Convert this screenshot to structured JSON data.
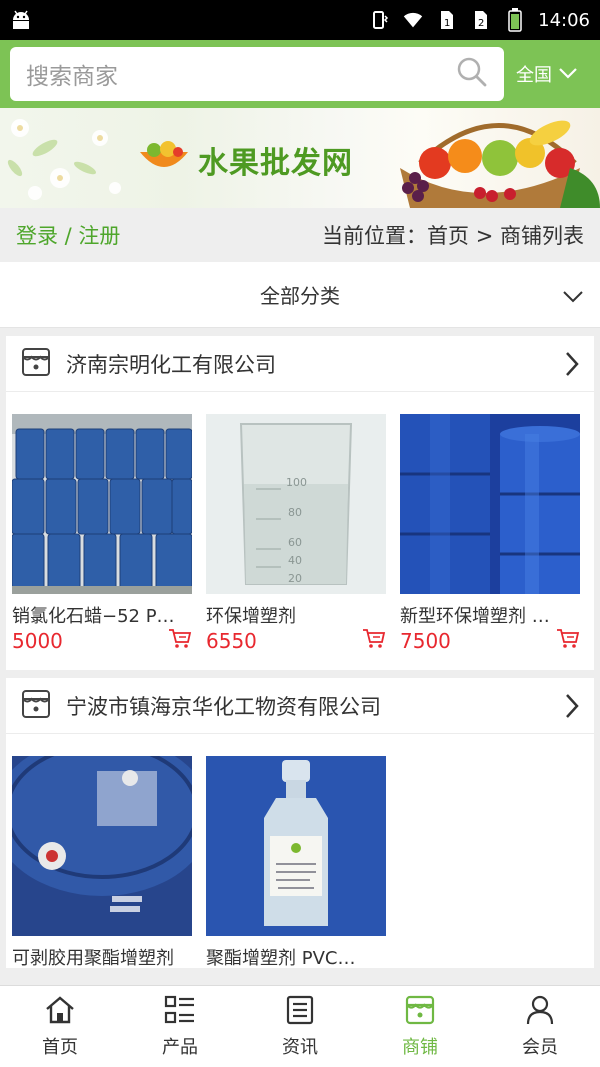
{
  "status_bar": {
    "time": "14:06"
  },
  "search": {
    "placeholder": "搜索商家",
    "region": "全国"
  },
  "banner": {
    "logo_text": "水果批发网"
  },
  "breadcrumb": {
    "login": "登录 / 注册",
    "location": "当前位置：首页 > 商铺列表"
  },
  "category": {
    "label": "全部分类"
  },
  "shops": [
    {
      "name": "济南宗明化工有限公司",
      "products": [
        {
          "name": "销氯化石蜡−52 P…",
          "price": "5000",
          "image": "blue-drums-warehouse"
        },
        {
          "name": "环保增塑剂",
          "price": "6550",
          "image": "glass-beaker-liquid"
        },
        {
          "name": "新型环保增塑剂 …",
          "price": "7500",
          "image": "blue-drums-closeup"
        }
      ]
    },
    {
      "name": "宁波市镇海京华化工物资有限公司",
      "products": [
        {
          "name": "可剥胶用聚酯增塑剂",
          "image": "blue-drum-top"
        },
        {
          "name": "聚酯增塑剂 PVC…",
          "image": "reagent-bottle"
        }
      ]
    }
  ],
  "nav": [
    {
      "label": "首页",
      "icon": "home-icon"
    },
    {
      "label": "产品",
      "icon": "list-icon"
    },
    {
      "label": "资讯",
      "icon": "news-icon"
    },
    {
      "label": "商铺",
      "icon": "shop-icon",
      "active": true
    },
    {
      "label": "会员",
      "icon": "user-icon"
    }
  ],
  "colors": {
    "accent": "#7dc355",
    "price": "#e8282f",
    "active_nav": "#6fb843"
  }
}
